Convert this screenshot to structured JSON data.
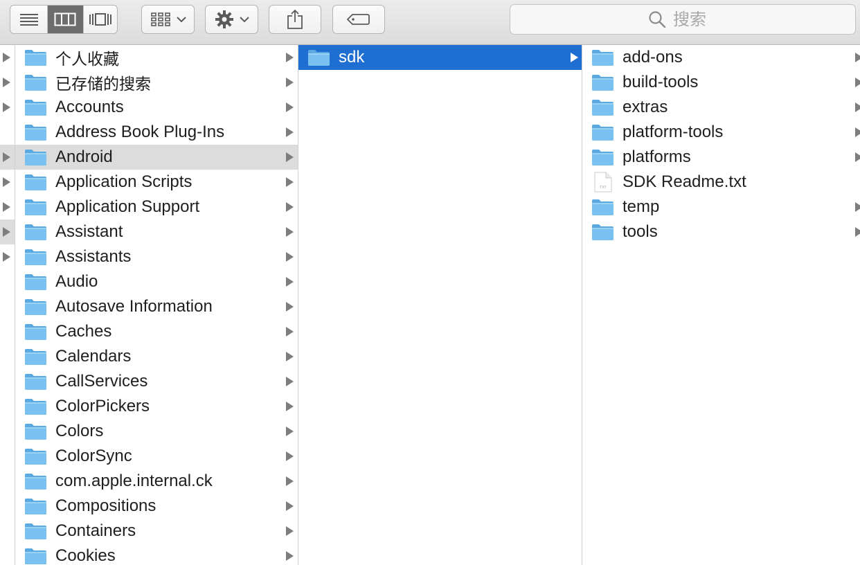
{
  "toolbar": {
    "view_modes": [
      {
        "name": "list-view",
        "icon": "list-view-icon",
        "active": false
      },
      {
        "name": "column-view",
        "icon": "column-view-icon",
        "active": true
      },
      {
        "name": "cover-flow-view",
        "icon": "cover-flow-icon",
        "active": false
      }
    ],
    "arrange_icon": "arrange-grid-icon",
    "action_icon": "gear-icon",
    "share_icon": "share-icon",
    "tags_icon": "tag-icon",
    "search": {
      "placeholder": "搜索",
      "value": ""
    }
  },
  "colors": {
    "selection_blue": "#1f6fd2",
    "selection_gray": "#dcdcdc",
    "folder_blue": "#6cb7ea"
  },
  "columns": {
    "parent": {
      "rows": [
        {
          "has_children": true
        },
        {
          "has_children": true
        },
        {
          "has_children": true
        },
        {
          "has_children": false
        },
        {
          "has_children": true,
          "selected": true
        },
        {
          "has_children": true
        },
        {
          "has_children": true
        },
        {
          "has_children": true,
          "selected": true
        },
        {
          "has_children": true
        }
      ]
    },
    "library": {
      "items": [
        {
          "label": "个人收藏",
          "has_children": true
        },
        {
          "label": "已存储的搜索",
          "has_children": true
        },
        {
          "label": "Accounts",
          "has_children": true
        },
        {
          "label": "Address Book Plug-Ins",
          "has_children": true
        },
        {
          "label": "Android",
          "has_children": true,
          "selected": true
        },
        {
          "label": "Application Scripts",
          "has_children": true
        },
        {
          "label": "Application Support",
          "has_children": true
        },
        {
          "label": "Assistant",
          "has_children": true
        },
        {
          "label": "Assistants",
          "has_children": true
        },
        {
          "label": "Audio",
          "has_children": true
        },
        {
          "label": "Autosave Information",
          "has_children": true
        },
        {
          "label": "Caches",
          "has_children": true
        },
        {
          "label": "Calendars",
          "has_children": true
        },
        {
          "label": "CallServices",
          "has_children": true
        },
        {
          "label": "ColorPickers",
          "has_children": true
        },
        {
          "label": "Colors",
          "has_children": true
        },
        {
          "label": "ColorSync",
          "has_children": true
        },
        {
          "label": "com.apple.internal.ck",
          "has_children": true
        },
        {
          "label": "Compositions",
          "has_children": true
        },
        {
          "label": "Containers",
          "has_children": true
        },
        {
          "label": "Cookies",
          "has_children": true
        }
      ]
    },
    "android": {
      "items": [
        {
          "label": "sdk",
          "has_children": true,
          "selected": true
        }
      ]
    },
    "sdk": {
      "items": [
        {
          "label": "add-ons",
          "type": "folder",
          "has_children": true
        },
        {
          "label": "build-tools",
          "type": "folder",
          "has_children": true
        },
        {
          "label": "extras",
          "type": "folder",
          "has_children": true
        },
        {
          "label": "platform-tools",
          "type": "folder",
          "has_children": true
        },
        {
          "label": "platforms",
          "type": "folder",
          "has_children": true
        },
        {
          "label": "SDK Readme.txt",
          "type": "file",
          "has_children": false
        },
        {
          "label": "temp",
          "type": "folder",
          "has_children": true
        },
        {
          "label": "tools",
          "type": "folder",
          "has_children": true
        }
      ]
    }
  }
}
